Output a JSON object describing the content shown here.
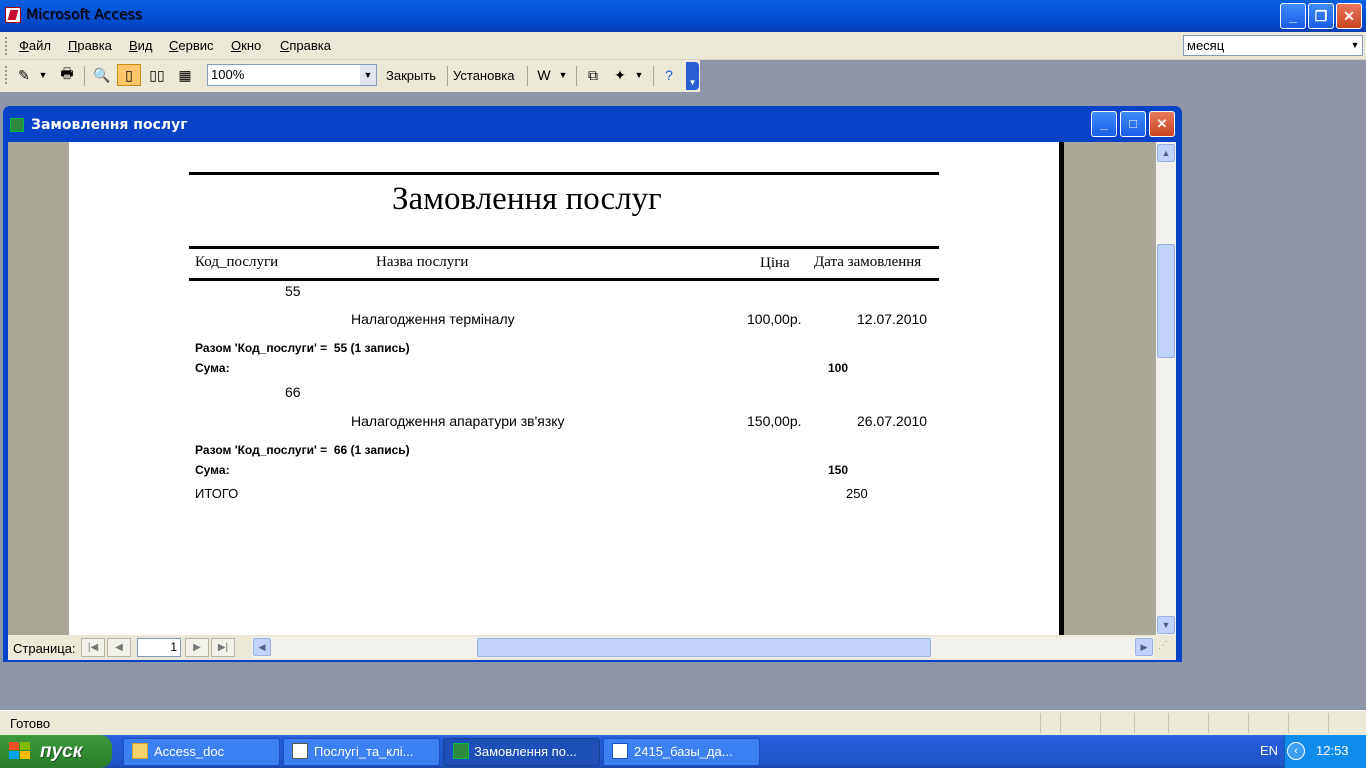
{
  "app": {
    "title": "Microsoft Access"
  },
  "menu": {
    "items": [
      {
        "label": "Файл",
        "u": "Ф",
        "rest": "айл"
      },
      {
        "label": "Правка",
        "u": "П",
        "rest": "равка"
      },
      {
        "label": "Вид",
        "u": "В",
        "rest": "ид"
      },
      {
        "label": "Сервис",
        "u": "С",
        "rest": "ервис"
      },
      {
        "label": "Окно",
        "u": "О",
        "rest": "кно"
      },
      {
        "label": "Справка",
        "u": "С",
        "rest": "правка"
      }
    ],
    "combo_value": "месяц"
  },
  "toolbar": {
    "zoom": "100%",
    "close_label": "Закрыть",
    "setup_label": "Установка"
  },
  "child": {
    "title": "Замовлення послуг"
  },
  "report": {
    "title": "Замовлення послуг",
    "headers": {
      "code": "Код_послуги",
      "name": "Назва послуги",
      "price": "Ціна",
      "date": "Дата замовлення"
    },
    "groups": [
      {
        "code": "55",
        "name": "Налагодження терміналу",
        "price": "100,00р.",
        "date": "12.07.2010",
        "summary": "Разом 'Код_послуги' =  55 (1 запись)",
        "sum_label": "Сума:",
        "sum_value": "100"
      },
      {
        "code": "66",
        "name": "Налагодження апаратури зв'язку",
        "price": "150,00р.",
        "date": "26.07.2010",
        "summary": "Разом 'Код_послуги' =  66 (1 запись)",
        "sum_label": "Сума:",
        "sum_value": "150"
      }
    ],
    "total_label": "ИТОГО",
    "total_value": "250"
  },
  "nav": {
    "label": "Страница:",
    "page": "1"
  },
  "status": {
    "text": "Готово"
  },
  "taskbar": {
    "start": "пуск",
    "tasks": [
      {
        "label": "Access_doc",
        "icon": "folder-icon"
      },
      {
        "label": "Послугі_та_клі...",
        "icon": "table-icon"
      },
      {
        "label": "Замовлення по...",
        "icon": "report-icon"
      },
      {
        "label": "2415_базы_да...",
        "icon": "word-doc-icon"
      }
    ],
    "lang": "EN",
    "clock": "12:53"
  }
}
